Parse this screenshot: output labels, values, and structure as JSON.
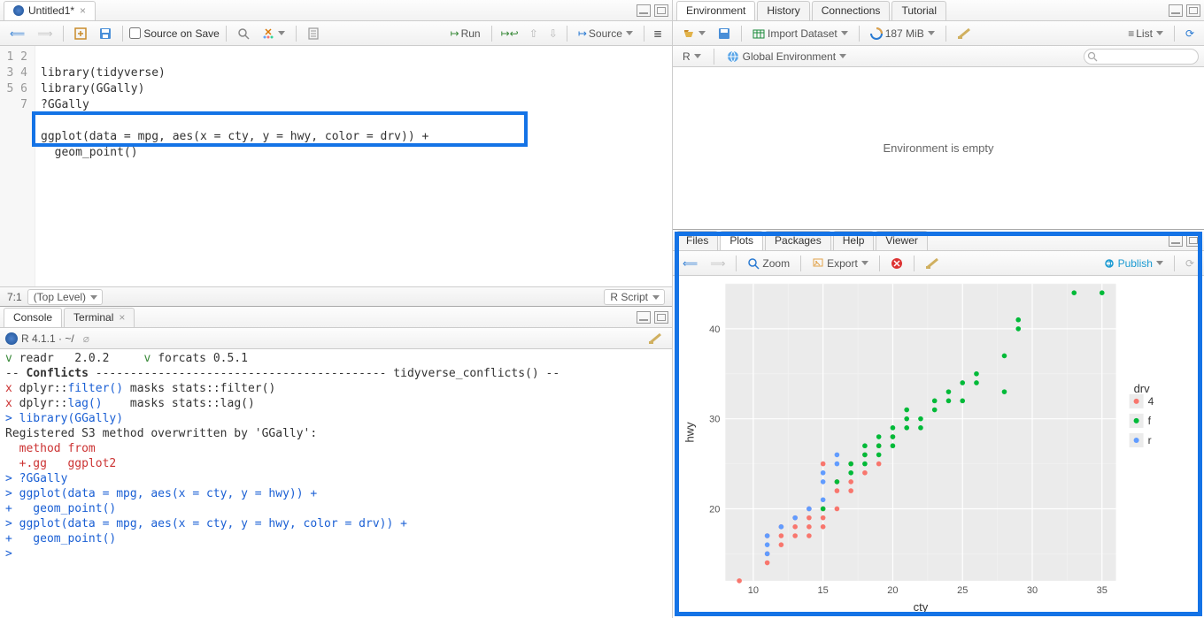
{
  "source": {
    "tab_title": "Untitled1*",
    "source_on_save": "Source on Save",
    "run": "Run",
    "source_btn": "Source",
    "lines": [
      "1",
      "2",
      "3",
      "4",
      "5",
      "6",
      "7"
    ],
    "code1": "library(tidyverse)",
    "code2": "library(GGally)",
    "code3": "?GGally",
    "code4": "",
    "code5": "ggplot(data = mpg, aes(x = cty, y = hwy, color = drv)) +",
    "code6": "  geom_point()",
    "cursor": "7:1",
    "scope": "(Top Level)",
    "lang": "R Script"
  },
  "console": {
    "tab_console": "Console",
    "tab_terminal": "Terminal",
    "r_ver": "R 4.1.1 · ~/",
    "out": [
      {
        "cls": "line",
        "spans": [
          {
            "c": "c-green",
            "t": "v "
          },
          {
            "c": "",
            "t": "readr   2.0.2     "
          },
          {
            "c": "c-green",
            "t": "v "
          },
          {
            "c": "",
            "t": "forcats 0.5.1"
          }
        ]
      },
      {
        "cls": "line",
        "spans": [
          {
            "c": "",
            "t": "-- "
          },
          {
            "c": "c-bold",
            "t": "Conflicts"
          },
          {
            "c": "",
            "t": " ------------------------------------------ tidyverse_conflicts() --"
          }
        ]
      },
      {
        "cls": "line",
        "spans": [
          {
            "c": "c-red",
            "t": "x "
          },
          {
            "c": "",
            "t": "dplyr::"
          },
          {
            "c": "c-blue",
            "t": "filter()"
          },
          {
            "c": "",
            "t": " masks "
          },
          {
            "c": "",
            "t": "stats::filter()"
          }
        ]
      },
      {
        "cls": "line",
        "spans": [
          {
            "c": "c-red",
            "t": "x "
          },
          {
            "c": "",
            "t": "dplyr::"
          },
          {
            "c": "c-blue",
            "t": "lag()"
          },
          {
            "c": "",
            "t": "    masks "
          },
          {
            "c": "",
            "t": "stats::lag()"
          }
        ]
      },
      {
        "cls": "line",
        "spans": [
          {
            "c": "c-blue",
            "t": "> library(GGally)"
          }
        ]
      },
      {
        "cls": "line",
        "spans": [
          {
            "c": "c-black",
            "t": "Registered S3 method overwritten by 'GGally':"
          }
        ]
      },
      {
        "cls": "line",
        "spans": [
          {
            "c": "c-red",
            "t": "  method from"
          }
        ]
      },
      {
        "cls": "line",
        "spans": [
          {
            "c": "c-red",
            "t": "  +.gg   ggplot2"
          }
        ]
      },
      {
        "cls": "line",
        "spans": [
          {
            "c": "c-blue",
            "t": "> ?GGally"
          }
        ]
      },
      {
        "cls": "line",
        "spans": [
          {
            "c": "c-blue",
            "t": "> ggplot(data = mpg, aes(x = cty, y = hwy)) +"
          }
        ]
      },
      {
        "cls": "line",
        "spans": [
          {
            "c": "c-blue",
            "t": "+   geom_point()"
          }
        ]
      },
      {
        "cls": "line",
        "spans": [
          {
            "c": "c-blue",
            "t": "> ggplot(data = mpg, aes(x = cty, y = hwy, color = drv)) +"
          }
        ]
      },
      {
        "cls": "line",
        "spans": [
          {
            "c": "c-blue",
            "t": "+   geom_point()"
          }
        ]
      },
      {
        "cls": "line",
        "spans": [
          {
            "c": "c-blue",
            "t": "> "
          }
        ]
      }
    ]
  },
  "env": {
    "tabs": {
      "env": "Environment",
      "hist": "History",
      "conn": "Connections",
      "tut": "Tutorial"
    },
    "import": "Import Dataset",
    "mem": "187 MiB",
    "list": "List",
    "r": "R",
    "scope": "Global Environment",
    "empty": "Environment is empty"
  },
  "plots": {
    "tabs": {
      "files": "Files",
      "plots": "Plots",
      "pkgs": "Packages",
      "help": "Help",
      "viewer": "Viewer"
    },
    "zoom": "Zoom",
    "export": "Export",
    "publish": "Publish"
  },
  "chart_data": {
    "type": "scatter",
    "xlabel": "cty",
    "ylabel": "hwy",
    "legend_title": "drv",
    "xlim": [
      8,
      36
    ],
    "ylim": [
      12,
      45
    ],
    "xticks": [
      10,
      15,
      20,
      25,
      30,
      35
    ],
    "yticks": [
      20,
      30,
      40
    ],
    "series": [
      {
        "name": "4",
        "color": "#F8766D",
        "points": [
          [
            9,
            12
          ],
          [
            11,
            14
          ],
          [
            11,
            15
          ],
          [
            11,
            17
          ],
          [
            12,
            16
          ],
          [
            12,
            17
          ],
          [
            12,
            18
          ],
          [
            13,
            17
          ],
          [
            13,
            18
          ],
          [
            13,
            19
          ],
          [
            14,
            17
          ],
          [
            14,
            18
          ],
          [
            14,
            19
          ],
          [
            14,
            20
          ],
          [
            15,
            18
          ],
          [
            15,
            19
          ],
          [
            15,
            20
          ],
          [
            16,
            20
          ],
          [
            16,
            22
          ],
          [
            16,
            23
          ],
          [
            17,
            22
          ],
          [
            17,
            23
          ],
          [
            17,
            25
          ],
          [
            18,
            24
          ],
          [
            18,
            26
          ],
          [
            19,
            25
          ],
          [
            19,
            27
          ],
          [
            20,
            28
          ],
          [
            15,
            25
          ]
        ]
      },
      {
        "name": "f",
        "color": "#00BA38",
        "points": [
          [
            15,
            20
          ],
          [
            16,
            23
          ],
          [
            17,
            24
          ],
          [
            17,
            25
          ],
          [
            18,
            25
          ],
          [
            18,
            26
          ],
          [
            18,
            27
          ],
          [
            19,
            26
          ],
          [
            19,
            27
          ],
          [
            19,
            28
          ],
          [
            20,
            27
          ],
          [
            20,
            28
          ],
          [
            20,
            29
          ],
          [
            21,
            29
          ],
          [
            21,
            30
          ],
          [
            21,
            31
          ],
          [
            22,
            29
          ],
          [
            22,
            30
          ],
          [
            23,
            31
          ],
          [
            23,
            32
          ],
          [
            24,
            32
          ],
          [
            24,
            33
          ],
          [
            25,
            32
          ],
          [
            25,
            34
          ],
          [
            26,
            34
          ],
          [
            26,
            35
          ],
          [
            28,
            37
          ],
          [
            28,
            33
          ],
          [
            29,
            40
          ],
          [
            29,
            41
          ],
          [
            33,
            44
          ],
          [
            35,
            44
          ]
        ]
      },
      {
        "name": "r",
        "color": "#619CFF",
        "points": [
          [
            11,
            15
          ],
          [
            11,
            16
          ],
          [
            11,
            17
          ],
          [
            12,
            18
          ],
          [
            13,
            19
          ],
          [
            14,
            20
          ],
          [
            15,
            21
          ],
          [
            15,
            23
          ],
          [
            15,
            24
          ],
          [
            16,
            25
          ],
          [
            16,
            26
          ]
        ]
      }
    ]
  }
}
